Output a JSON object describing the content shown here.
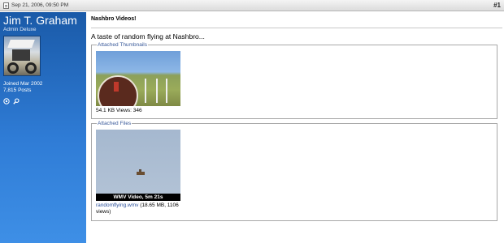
{
  "post_header": {
    "date": "Sep 21, 2006, 09:50 PM",
    "post_number": "#1"
  },
  "user": {
    "name": "Jim T. Graham",
    "rank": "Admin Deluxe",
    "joined": "Joined Mar 2002",
    "posts": "7,815 Posts",
    "icons": [
      "status-icon",
      "search-icon"
    ]
  },
  "post": {
    "title": "Nashbro Videos!",
    "message": "A taste of random flying at Nashbro..."
  },
  "attached_thumbnails": {
    "legend": "Attached Thumbnails",
    "items": [
      {
        "caption": "54.1 KB   Views: 346"
      }
    ]
  },
  "attached_files": {
    "legend": "Attached Files",
    "items": [
      {
        "overlay": "WMV Video, 5m 21s",
        "filename": "randomflying.wmv",
        "meta": "(18.65 MB, 1106 views)"
      }
    ]
  },
  "colors": {
    "sidebar_top": "#1a5aa8",
    "sidebar_bottom": "#3e8fe6",
    "link": "#2a4f9a"
  }
}
